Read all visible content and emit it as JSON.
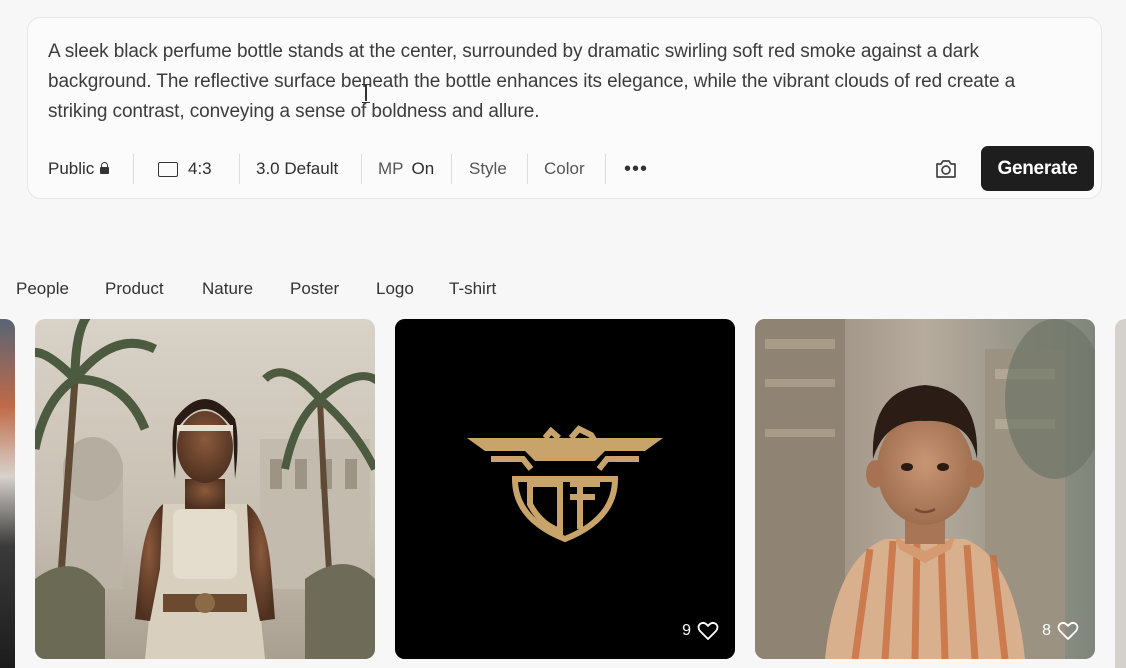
{
  "prompt": {
    "text": "A sleek black perfume bottle stands at the center, surrounded by dramatic swirling soft red smoke against a dark background. The reflective surface beneath the bottle enhances its elegance, while the vibrant clouds of red create a striking contrast, conveying a sense of boldness and allure."
  },
  "toolbar": {
    "visibility_label": "Public",
    "visibility_icon": "lock-icon",
    "aspect_ratio": "4:3",
    "aspect_icon": "rectangle-icon",
    "model": "3.0 Default",
    "mp_label": "MP",
    "mp_value": "On",
    "style_label": "Style",
    "color_label": "Color",
    "more_icon": "more-dots-icon",
    "camera_icon": "camera-icon",
    "generate_label": "Generate"
  },
  "categories": [
    "People",
    "Product",
    "Nature",
    "Poster",
    "Logo",
    "T-shirt"
  ],
  "gallery": [
    {
      "subject": "warrior-woman-illustration"
    },
    {
      "subject": "gold-eagle-logo",
      "likes": "9",
      "like_icon": "heart-icon"
    },
    {
      "subject": "boy-portrait-photo",
      "likes": "8",
      "like_icon": "heart-icon"
    }
  ],
  "colors": {
    "background": "#f7f7f7",
    "generate_button": "#1e1e1e",
    "logo_gold": "#c9a46a",
    "logo_bg": "#000000"
  }
}
